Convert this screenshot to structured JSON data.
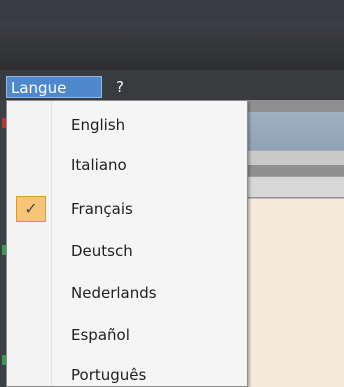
{
  "menubar": {
    "items": [
      {
        "label": "Langue",
        "active": true
      },
      {
        "label": "?"
      }
    ]
  },
  "dropdown": {
    "items": [
      {
        "label": "English"
      },
      {
        "label": "Italiano"
      },
      {
        "label": "Français",
        "checked": true
      },
      {
        "label": "Deutsch"
      },
      {
        "label": "Nederlands"
      },
      {
        "label": "Español"
      },
      {
        "label": "Português"
      }
    ],
    "check_icon": "check-icon"
  },
  "colors": {
    "menu_highlight": "#4f89cc",
    "check_bg": "#f7c57a",
    "dropdown_bg": "#f5f5f5"
  }
}
